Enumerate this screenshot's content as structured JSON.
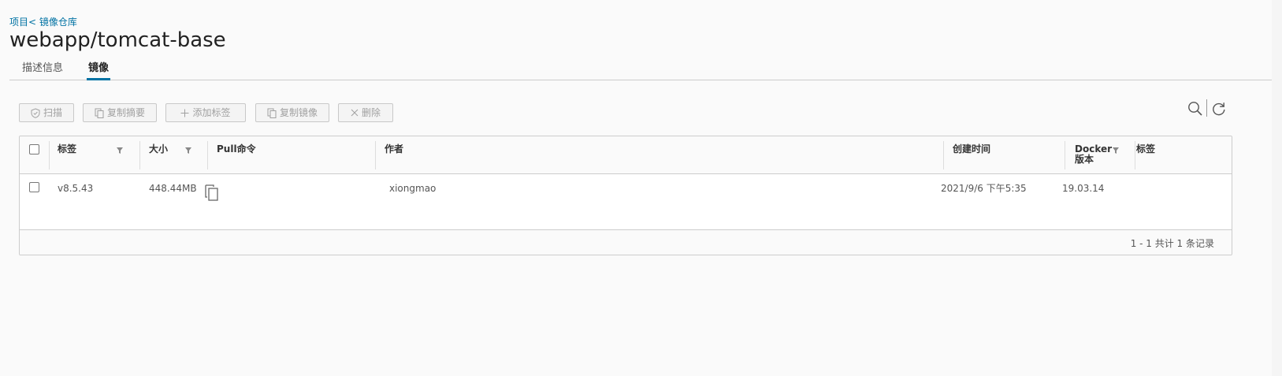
{
  "breadcrumb": {
    "project": "项目",
    "separator": "<",
    "repository": "镜像仓库"
  },
  "title": "webapp/tomcat-base",
  "tabs": [
    {
      "label": "描述信息",
      "active": false
    },
    {
      "label": "镜像",
      "active": true
    }
  ],
  "toolbar": {
    "scan_label": "扫描",
    "copy_digest_label": "复制摘要",
    "add_label_label": "添加标签",
    "copy_image_label": "复制镜像",
    "delete_label": "删除",
    "icons": {
      "scan": "shield-icon",
      "copy_digest": "copy-icon",
      "add_label": "plus-icon",
      "copy_image": "copy-icon",
      "delete": "close-icon",
      "search": "search-icon",
      "refresh": "refresh-icon"
    }
  },
  "table": {
    "headers": {
      "tag": "标签",
      "size": "大小",
      "pull": "Pull命令",
      "author": "作者",
      "created": "创建时间",
      "docker_line1": "Docker",
      "docker_line2": "版本",
      "labels": "标签"
    },
    "rows": [
      {
        "tag": "v8.5.43",
        "size": "448.44MB",
        "pull_icon": "copy-icon",
        "author": "xiongmao",
        "created": "2021/9/6 下午5:35",
        "docker": "19.03.14",
        "labels": ""
      }
    ],
    "footer": "1 - 1 共计 1 条记录"
  },
  "colors": {
    "link": "#0072a3",
    "tab_active_underline": "#0072a3",
    "disabled_text": "#a0a0a0",
    "border": "#cccccc",
    "background": "#fafafa"
  }
}
